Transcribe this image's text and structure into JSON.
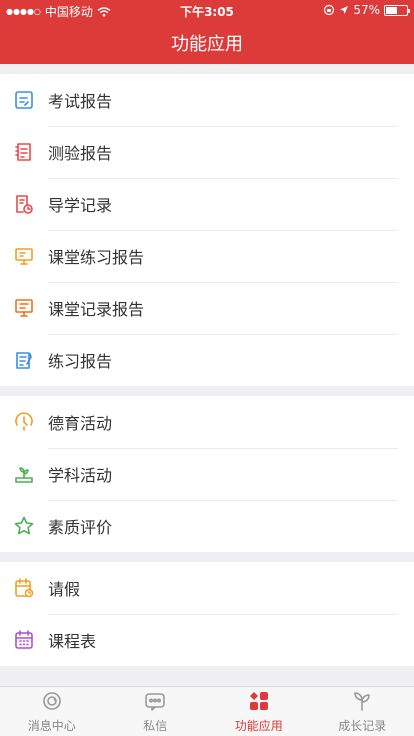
{
  "status_bar": {
    "carrier": "中国移动",
    "time": "下午3:05",
    "battery_percent": "57%",
    "battery_level": 0.57
  },
  "header": {
    "title": "功能应用"
  },
  "groups": [
    {
      "items": [
        {
          "label": "考试报告",
          "icon": "exam-report-icon",
          "color": "#3a8ee6"
        },
        {
          "label": "测验报告",
          "icon": "quiz-report-icon",
          "color": "#e84a4a"
        },
        {
          "label": "导学记录",
          "icon": "guide-record-icon",
          "color": "#e84a4a"
        },
        {
          "label": "课堂练习报告",
          "icon": "class-exercise-icon",
          "color": "#f0a020"
        },
        {
          "label": "课堂记录报告",
          "icon": "class-record-icon",
          "color": "#f07020"
        },
        {
          "label": "练习报告",
          "icon": "practice-report-icon",
          "color": "#3a8ee6"
        }
      ]
    },
    {
      "items": [
        {
          "label": "德育活动",
          "icon": "moral-activity-icon",
          "color": "#f0a020"
        },
        {
          "label": "学科活动",
          "icon": "subject-activity-icon",
          "color": "#4cb050"
        },
        {
          "label": "素质评价",
          "icon": "quality-evaluation-icon",
          "color": "#4cb050"
        }
      ]
    },
    {
      "items": [
        {
          "label": "请假",
          "icon": "leave-request-icon",
          "color": "#f0a020"
        },
        {
          "label": "课程表",
          "icon": "timetable-icon",
          "color": "#b050d0"
        }
      ]
    }
  ],
  "tabbar": {
    "tabs": [
      {
        "label": "消息中心",
        "icon": "message-center-icon",
        "active": false
      },
      {
        "label": "私信",
        "icon": "private-message-icon",
        "active": false
      },
      {
        "label": "功能应用",
        "icon": "apps-icon",
        "active": true
      },
      {
        "label": "成长记录",
        "icon": "growth-record-icon",
        "active": false
      }
    ]
  }
}
